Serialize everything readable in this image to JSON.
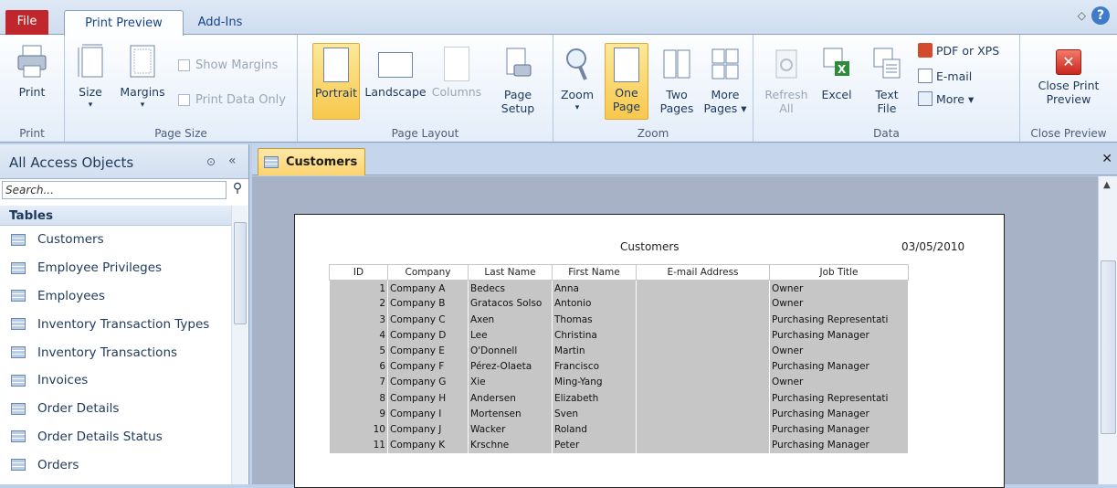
{
  "tabs": {
    "file": "File",
    "print_preview": "Print Preview",
    "add_ins": "Add-Ins"
  },
  "ribbon": {
    "print": {
      "button": "Print",
      "group": "Print"
    },
    "page_size": {
      "size": "Size",
      "margins": "Margins",
      "show_margins": "Show Margins",
      "print_data_only": "Print Data Only",
      "group": "Page Size"
    },
    "page_layout": {
      "portrait": "Portrait",
      "landscape": "Landscape",
      "columns": "Columns",
      "page_setup_1": "Page",
      "page_setup_2": "Setup",
      "group": "Page Layout"
    },
    "zoom": {
      "zoom": "Zoom",
      "one_page_1": "One",
      "one_page_2": "Page",
      "two_pages_1": "Two",
      "two_pages_2": "Pages",
      "more_pages_1": "More",
      "more_pages_2": "Pages ▾",
      "group": "Zoom"
    },
    "data": {
      "refresh_1": "Refresh",
      "refresh_2": "All",
      "excel": "Excel",
      "text_file_1": "Text",
      "text_file_2": "File",
      "pdf": "PDF or XPS",
      "email": "E-mail",
      "more": "More ▾",
      "group": "Data"
    },
    "close": {
      "label_1": "Close Print",
      "label_2": "Preview",
      "group": "Close Preview"
    }
  },
  "nav": {
    "title": "All Access Objects",
    "search_placeholder": "Search...",
    "group": "Tables",
    "items": [
      "Customers",
      "Employee Privileges",
      "Employees",
      "Inventory Transaction Types",
      "Inventory Transactions",
      "Invoices",
      "Order Details",
      "Order Details Status",
      "Orders"
    ]
  },
  "document": {
    "tab": "Customers"
  },
  "report": {
    "title": "Customers",
    "date": "03/05/2010",
    "columns": [
      "ID",
      "Company",
      "Last Name",
      "First Name",
      "E-mail Address",
      "Job Title"
    ],
    "rows": [
      [
        "1",
        "Company A",
        "Bedecs",
        "Anna",
        "",
        "Owner"
      ],
      [
        "2",
        "Company B",
        "Gratacos Solso",
        "Antonio",
        "",
        "Owner"
      ],
      [
        "3",
        "Company C",
        "Axen",
        "Thomas",
        "",
        "Purchasing Representati"
      ],
      [
        "4",
        "Company D",
        "Lee",
        "Christina",
        "",
        "Purchasing Manager"
      ],
      [
        "5",
        "Company E",
        "O'Donnell",
        "Martin",
        "",
        "Owner"
      ],
      [
        "6",
        "Company F",
        "Pérez-Olaeta",
        "Francisco",
        "",
        "Purchasing Manager"
      ],
      [
        "7",
        "Company G",
        "Xie",
        "Ming-Yang",
        "",
        "Owner"
      ],
      [
        "8",
        "Company H",
        "Andersen",
        "Elizabeth",
        "",
        "Purchasing Representati"
      ],
      [
        "9",
        "Company I",
        "Mortensen",
        "Sven",
        "",
        "Purchasing Manager"
      ],
      [
        "10",
        "Company J",
        "Wacker",
        "Roland",
        "",
        "Purchasing Manager"
      ],
      [
        "11",
        "Company K",
        "Krschne",
        "Peter",
        "",
        "Purchasing Manager"
      ]
    ]
  }
}
